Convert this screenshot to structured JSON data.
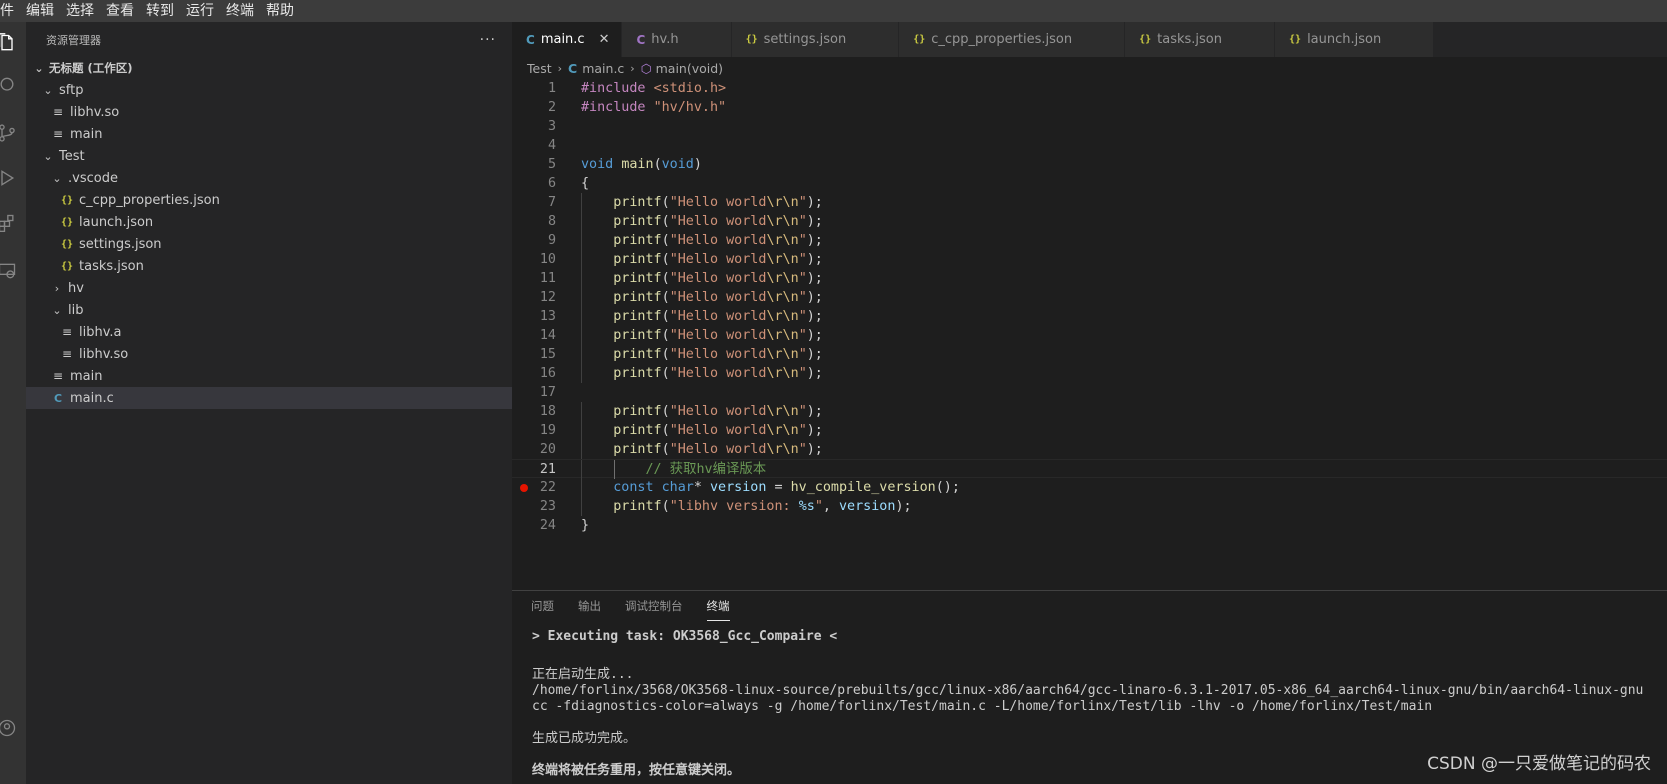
{
  "menubar": {
    "items": [
      "件",
      "编辑",
      "选择",
      "查看",
      "转到",
      "运行",
      "终端",
      "帮助"
    ]
  },
  "activity_bar": {
    "icons": [
      "files-icon",
      "search-icon",
      "source-control-icon",
      "run-debug-icon",
      "extensions-icon",
      "remote-explorer-icon",
      "account-icon"
    ]
  },
  "sidebar": {
    "title": "资源管理器",
    "more": "···",
    "workspace": "无标题 (工作区)",
    "tree": [
      {
        "label": "sftp",
        "kind": "folder-open",
        "depth": 1
      },
      {
        "label": "libhv.so",
        "kind": "file",
        "depth": 2
      },
      {
        "label": "main",
        "kind": "file",
        "depth": 2
      },
      {
        "label": "Test",
        "kind": "folder-open",
        "depth": 1
      },
      {
        "label": ".vscode",
        "kind": "folder-open",
        "depth": 2
      },
      {
        "label": "c_cpp_properties.json",
        "kind": "json",
        "depth": 3
      },
      {
        "label": "launch.json",
        "kind": "json",
        "depth": 3
      },
      {
        "label": "settings.json",
        "kind": "json",
        "depth": 3
      },
      {
        "label": "tasks.json",
        "kind": "json",
        "depth": 3
      },
      {
        "label": "hv",
        "kind": "folder-closed",
        "depth": 2
      },
      {
        "label": "lib",
        "kind": "folder-open",
        "depth": 2
      },
      {
        "label": "libhv.a",
        "kind": "file",
        "depth": 3
      },
      {
        "label": "libhv.so",
        "kind": "file",
        "depth": 3
      },
      {
        "label": "main",
        "kind": "file",
        "depth": 2
      },
      {
        "label": "main.c",
        "kind": "c",
        "depth": 2,
        "selected": true
      }
    ]
  },
  "tabs": [
    {
      "label": "main.c",
      "icon": "C",
      "type": "c",
      "active": true,
      "close": "✕"
    },
    {
      "label": "hv.h",
      "icon": "C",
      "type": "h"
    },
    {
      "label": "settings.json",
      "icon": "{}",
      "type": "json"
    },
    {
      "label": "c_cpp_properties.json",
      "icon": "{}",
      "type": "json"
    },
    {
      "label": "tasks.json",
      "icon": "{}",
      "type": "json"
    },
    {
      "label": "launch.json",
      "icon": "{}",
      "type": "json"
    }
  ],
  "breadcrumb": {
    "folder": "Test",
    "file_icon": "C",
    "file": "main.c",
    "symbol": "main(void)"
  },
  "code": {
    "current_line": 21,
    "breakpoint_line": 22,
    "lines": [
      [
        {
          "t": "pp",
          "v": "#include "
        },
        {
          "t": "str",
          "v": "<stdio.h>"
        }
      ],
      [
        {
          "t": "pp",
          "v": "#include "
        },
        {
          "t": "str",
          "v": "\"hv/hv.h\""
        }
      ],
      [],
      [],
      [
        {
          "t": "kw",
          "v": "void"
        },
        {
          "t": "",
          "v": " "
        },
        {
          "t": "fn",
          "v": "main"
        },
        {
          "t": "",
          "v": "("
        },
        {
          "t": "kw",
          "v": "void"
        },
        {
          "t": "",
          "v": ")"
        }
      ],
      [
        {
          "t": "",
          "v": "{"
        }
      ],
      [
        {
          "t": "",
          "v": "    "
        },
        {
          "t": "fn",
          "v": "printf"
        },
        {
          "t": "",
          "v": "("
        },
        {
          "t": "str",
          "v": "\"Hello world"
        },
        {
          "t": "esc",
          "v": "\\r\\n"
        },
        {
          "t": "str",
          "v": "\""
        },
        {
          "t": "",
          "v": ");"
        }
      ],
      [
        {
          "t": "",
          "v": "    "
        },
        {
          "t": "fn",
          "v": "printf"
        },
        {
          "t": "",
          "v": "("
        },
        {
          "t": "str",
          "v": "\"Hello world"
        },
        {
          "t": "esc",
          "v": "\\r\\n"
        },
        {
          "t": "str",
          "v": "\""
        },
        {
          "t": "",
          "v": ");"
        }
      ],
      [
        {
          "t": "",
          "v": "    "
        },
        {
          "t": "fn",
          "v": "printf"
        },
        {
          "t": "",
          "v": "("
        },
        {
          "t": "str",
          "v": "\"Hello world"
        },
        {
          "t": "esc",
          "v": "\\r\\n"
        },
        {
          "t": "str",
          "v": "\""
        },
        {
          "t": "",
          "v": ");"
        }
      ],
      [
        {
          "t": "",
          "v": "    "
        },
        {
          "t": "fn",
          "v": "printf"
        },
        {
          "t": "",
          "v": "("
        },
        {
          "t": "str",
          "v": "\"Hello world"
        },
        {
          "t": "esc",
          "v": "\\r\\n"
        },
        {
          "t": "str",
          "v": "\""
        },
        {
          "t": "",
          "v": ");"
        }
      ],
      [
        {
          "t": "",
          "v": "    "
        },
        {
          "t": "fn",
          "v": "printf"
        },
        {
          "t": "",
          "v": "("
        },
        {
          "t": "str",
          "v": "\"Hello world"
        },
        {
          "t": "esc",
          "v": "\\r\\n"
        },
        {
          "t": "str",
          "v": "\""
        },
        {
          "t": "",
          "v": ");"
        }
      ],
      [
        {
          "t": "",
          "v": "    "
        },
        {
          "t": "fn",
          "v": "printf"
        },
        {
          "t": "",
          "v": "("
        },
        {
          "t": "str",
          "v": "\"Hello world"
        },
        {
          "t": "esc",
          "v": "\\r\\n"
        },
        {
          "t": "str",
          "v": "\""
        },
        {
          "t": "",
          "v": ");"
        }
      ],
      [
        {
          "t": "",
          "v": "    "
        },
        {
          "t": "fn",
          "v": "printf"
        },
        {
          "t": "",
          "v": "("
        },
        {
          "t": "str",
          "v": "\"Hello world"
        },
        {
          "t": "esc",
          "v": "\\r\\n"
        },
        {
          "t": "str",
          "v": "\""
        },
        {
          "t": "",
          "v": ");"
        }
      ],
      [
        {
          "t": "",
          "v": "    "
        },
        {
          "t": "fn",
          "v": "printf"
        },
        {
          "t": "",
          "v": "("
        },
        {
          "t": "str",
          "v": "\"Hello world"
        },
        {
          "t": "esc",
          "v": "\\r\\n"
        },
        {
          "t": "str",
          "v": "\""
        },
        {
          "t": "",
          "v": ");"
        }
      ],
      [
        {
          "t": "",
          "v": "    "
        },
        {
          "t": "fn",
          "v": "printf"
        },
        {
          "t": "",
          "v": "("
        },
        {
          "t": "str",
          "v": "\"Hello world"
        },
        {
          "t": "esc",
          "v": "\\r\\n"
        },
        {
          "t": "str",
          "v": "\""
        },
        {
          "t": "",
          "v": ");"
        }
      ],
      [
        {
          "t": "",
          "v": "    "
        },
        {
          "t": "fn",
          "v": "printf"
        },
        {
          "t": "",
          "v": "("
        },
        {
          "t": "str",
          "v": "\"Hello world"
        },
        {
          "t": "esc",
          "v": "\\r\\n"
        },
        {
          "t": "str",
          "v": "\""
        },
        {
          "t": "",
          "v": ");"
        }
      ],
      [],
      [
        {
          "t": "",
          "v": "    "
        },
        {
          "t": "fn",
          "v": "printf"
        },
        {
          "t": "",
          "v": "("
        },
        {
          "t": "str",
          "v": "\"Hello world"
        },
        {
          "t": "esc",
          "v": "\\r\\n"
        },
        {
          "t": "str",
          "v": "\""
        },
        {
          "t": "",
          "v": ");"
        }
      ],
      [
        {
          "t": "",
          "v": "    "
        },
        {
          "t": "fn",
          "v": "printf"
        },
        {
          "t": "",
          "v": "("
        },
        {
          "t": "str",
          "v": "\"Hello world"
        },
        {
          "t": "esc",
          "v": "\\r\\n"
        },
        {
          "t": "str",
          "v": "\""
        },
        {
          "t": "",
          "v": ");"
        }
      ],
      [
        {
          "t": "",
          "v": "    "
        },
        {
          "t": "fn",
          "v": "printf"
        },
        {
          "t": "",
          "v": "("
        },
        {
          "t": "str",
          "v": "\"Hello world"
        },
        {
          "t": "esc",
          "v": "\\r\\n"
        },
        {
          "t": "str",
          "v": "\""
        },
        {
          "t": "",
          "v": ");"
        }
      ],
      [
        {
          "t": "",
          "v": "        "
        },
        {
          "t": "cm",
          "v": "// 获取hv编译版本"
        }
      ],
      [
        {
          "t": "",
          "v": "    "
        },
        {
          "t": "kw",
          "v": "const"
        },
        {
          "t": "",
          "v": " "
        },
        {
          "t": "kw",
          "v": "char"
        },
        {
          "t": "",
          "v": "* "
        },
        {
          "t": "var",
          "v": "version"
        },
        {
          "t": "",
          "v": " = "
        },
        {
          "t": "fn",
          "v": "hv_compile_version"
        },
        {
          "t": "",
          "v": "();"
        }
      ],
      [
        {
          "t": "",
          "v": "    "
        },
        {
          "t": "fn",
          "v": "printf"
        },
        {
          "t": "",
          "v": "("
        },
        {
          "t": "str",
          "v": "\"libhv version: "
        },
        {
          "t": "var",
          "v": "%s"
        },
        {
          "t": "str",
          "v": "\""
        },
        {
          "t": "",
          "v": ", "
        },
        {
          "t": "var",
          "v": "version"
        },
        {
          "t": "",
          "v": ");"
        }
      ],
      [
        {
          "t": "",
          "v": "}"
        }
      ]
    ]
  },
  "panel": {
    "tabs": [
      "问题",
      "输出",
      "调试控制台",
      "终端"
    ],
    "active_tab": 3,
    "terminal": [
      {
        "text": "> Executing task: OK3568_Gcc_Compaire <",
        "bold": true
      },
      {
        "text": "",
        "bold": false
      },
      {
        "text": "正在启动生成...",
        "bold": false
      },
      {
        "text": "/home/forlinx/3568/OK3568-linux-source/prebuilts/gcc/linux-x86/aarch64/gcc-linaro-6.3.1-2017.05-x86_64_aarch64-linux-gnu/bin/aarch64-linux-gnu",
        "bold": false
      },
      {
        "text": "cc -fdiagnostics-color=always -g /home/forlinx/Test/main.c -L/home/forlinx/Test/lib -lhv -o /home/forlinx/Test/main",
        "bold": false
      },
      {
        "text": "",
        "bold": false
      },
      {
        "text": "生成已成功完成。",
        "bold": false
      },
      {
        "text": "",
        "bold": false
      },
      {
        "text": "终端将被任务重用，按任意键关闭。",
        "bold": true
      }
    ]
  },
  "watermark": "CSDN @一只爱做笔记的码农"
}
